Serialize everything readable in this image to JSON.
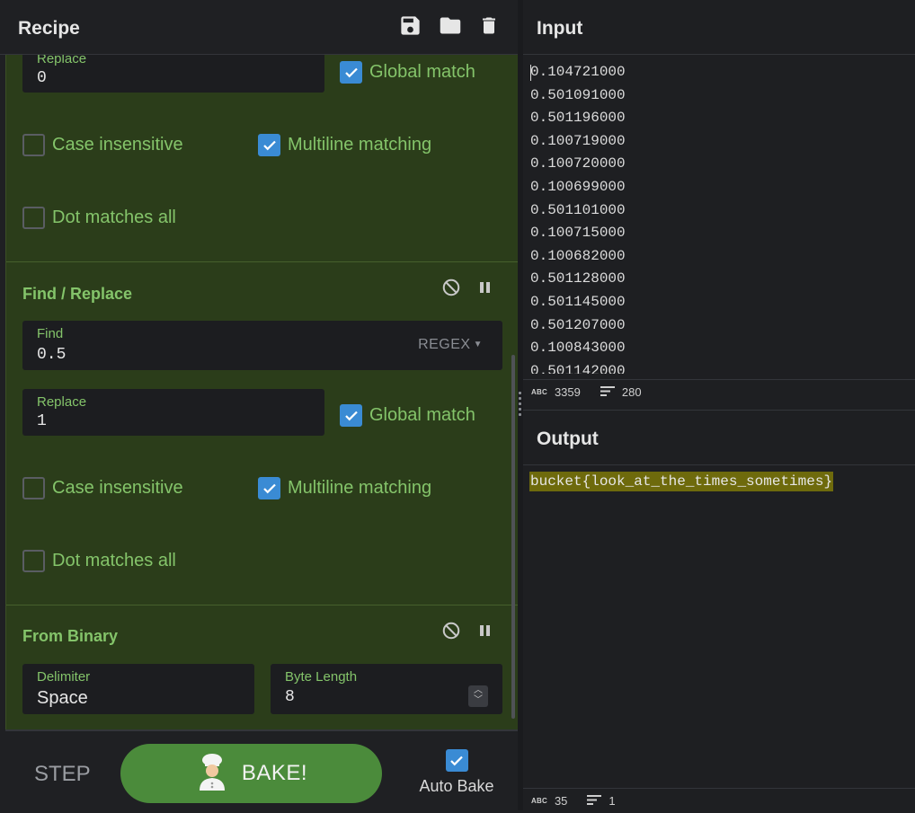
{
  "recipe": {
    "title": "Recipe",
    "icons": {
      "save": "save-icon",
      "load": "folder-icon",
      "clear": "trash-icon"
    }
  },
  "ops": [
    {
      "replace_label": "Replace",
      "replace_value": "0",
      "global_match": {
        "label": "Global match",
        "checked": true
      },
      "case_insensitive": {
        "label": "Case insensitive",
        "checked": false
      },
      "multiline": {
        "label": "Multiline matching",
        "checked": true
      },
      "dot_all": {
        "label": "Dot matches all",
        "checked": false
      }
    },
    {
      "title": "Find / Replace",
      "find_label": "Find",
      "find_value": "0.5",
      "find_mode": "REGEX",
      "replace_label": "Replace",
      "replace_value": "1",
      "global_match": {
        "label": "Global match",
        "checked": true
      },
      "case_insensitive": {
        "label": "Case insensitive",
        "checked": false
      },
      "multiline": {
        "label": "Multiline matching",
        "checked": true
      },
      "dot_all": {
        "label": "Dot matches all",
        "checked": false
      }
    },
    {
      "title": "From Binary",
      "delimiter_label": "Delimiter",
      "delimiter_value": "Space",
      "byte_length_label": "Byte Length",
      "byte_length_value": "8"
    }
  ],
  "controls": {
    "step_label": "STEP",
    "bake_label": "BAKE!",
    "autobake_label": "Auto Bake",
    "autobake_checked": true
  },
  "input": {
    "title": "Input",
    "lines": [
      "0.104721000",
      "0.501091000",
      "0.501196000",
      "0.100719000",
      "0.100720000",
      "0.100699000",
      "0.501101000",
      "0.100715000",
      "0.100682000",
      "0.501128000",
      "0.501145000",
      "0.501207000",
      "0.100843000",
      "0.501142000"
    ],
    "status": {
      "chars": "3359",
      "lines": "280"
    }
  },
  "output": {
    "title": "Output",
    "text": "bucket{look_at_the_times_sometimes}",
    "status": {
      "chars": "35",
      "lines": "1"
    }
  },
  "colors": {
    "accent_green": "#84c46a",
    "recipe_bg": "#2b3d1a",
    "checkbox_on": "#3a8bd4",
    "bake_button": "#4b8b3b",
    "output_highlight": "#6e6a0c"
  }
}
